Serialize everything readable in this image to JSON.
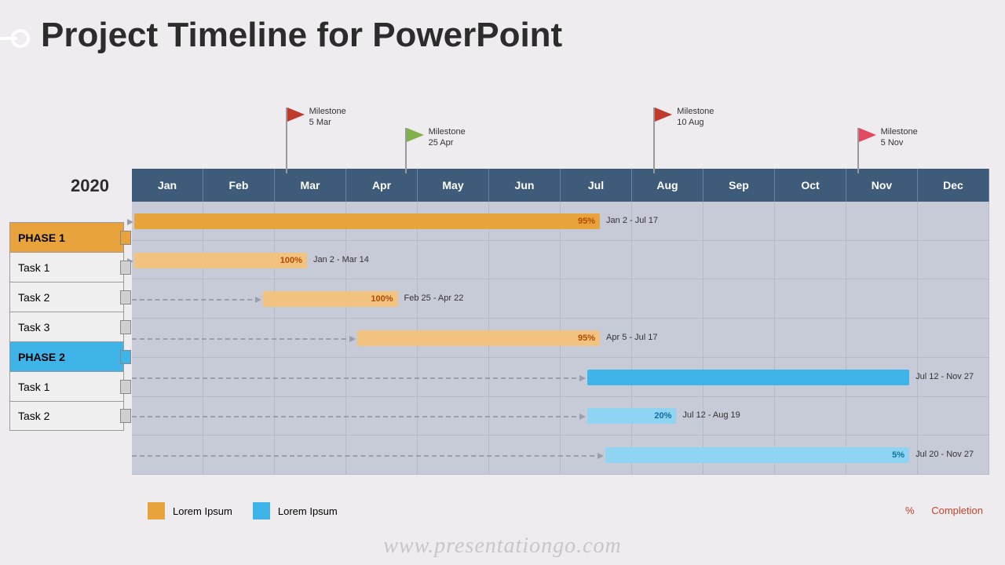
{
  "title": "Project Timeline for PowerPoint",
  "year": "2020",
  "months": [
    "Jan",
    "Feb",
    "Mar",
    "Apr",
    "May",
    "Jun",
    "Jul",
    "Aug",
    "Sep",
    "Oct",
    "Nov",
    "Dec"
  ],
  "rows": [
    {
      "label": "PHASE 1",
      "cls": "phase1",
      "handle": "p1"
    },
    {
      "label": "Task 1",
      "cls": "",
      "handle": ""
    },
    {
      "label": "Task 2",
      "cls": "",
      "handle": ""
    },
    {
      "label": "Task 3",
      "cls": "",
      "handle": ""
    },
    {
      "label": "PHASE 2",
      "cls": "phase2",
      "handle": "p2"
    },
    {
      "label": "Task 1",
      "cls": "",
      "handle": ""
    },
    {
      "label": "Task 2",
      "cls": "",
      "handle": ""
    }
  ],
  "milestones": [
    {
      "label1": "Milestone",
      "label2": "5 Mar",
      "color": "#c0392b",
      "col": 2.15,
      "high": true
    },
    {
      "label1": "Milestone",
      "label2": "25 Apr",
      "color": "#7fb24a",
      "col": 3.82,
      "high": false
    },
    {
      "label1": "Milestone",
      "label2": "10 Aug",
      "color": "#c0392b",
      "col": 7.3,
      "high": true
    },
    {
      "label1": "Milestone",
      "label2": "5 Nov",
      "color": "#e14b60",
      "col": 10.15,
      "high": false
    }
  ],
  "legend": [
    {
      "label": "Lorem Ipsum",
      "color": "#e8a33d"
    },
    {
      "label": "Lorem Ipsum",
      "color": "#3fb4e8"
    }
  ],
  "completion_pct": "%",
  "completion_label": "Completion",
  "watermark": "www.presentationgo.com",
  "chart_data": {
    "type": "gantt",
    "year": 2020,
    "x_axis_units": "months",
    "categories": [
      "Jan",
      "Feb",
      "Mar",
      "Apr",
      "May",
      "Jun",
      "Jul",
      "Aug",
      "Sep",
      "Oct",
      "Nov",
      "Dec"
    ],
    "rows": [
      {
        "name": "PHASE 1",
        "type": "phase",
        "start": "Jan 2",
        "end": "Jul 17",
        "start_m": 0.03,
        "end_m": 6.55,
        "pct": "95%",
        "color": "#e8a33d",
        "series": "Lorem Ipsum (orange)"
      },
      {
        "name": "Task 1",
        "type": "task",
        "start": "Jan 2",
        "end": "Mar 14",
        "start_m": 0.03,
        "end_m": 2.45,
        "pct": "100%",
        "color": "#f2c380",
        "series": "Lorem Ipsum (orange)"
      },
      {
        "name": "Task 2",
        "type": "task",
        "start": "Feb 25",
        "end": "Apr 22",
        "start_m": 1.83,
        "end_m": 3.72,
        "pct": "100%",
        "color": "#f2c380",
        "series": "Lorem Ipsum (orange)"
      },
      {
        "name": "Task 3",
        "type": "task",
        "start": "Apr 5",
        "end": "Jul 17",
        "start_m": 3.15,
        "end_m": 6.55,
        "pct": "95%",
        "color": "#f2c380",
        "series": "Lorem Ipsum (orange)"
      },
      {
        "name": "PHASE 2",
        "type": "phase",
        "start": "Jul 12",
        "end": "Nov 27",
        "start_m": 6.37,
        "end_m": 10.88,
        "pct": "",
        "color": "#3fb4e8",
        "series": "Lorem Ipsum (blue)"
      },
      {
        "name": "Task 1",
        "type": "task",
        "start": "Jul 12",
        "end": "Aug 19",
        "start_m": 6.37,
        "end_m": 7.62,
        "pct": "20%",
        "color": "#8fd4f2",
        "series": "Lorem Ipsum (blue)"
      },
      {
        "name": "Task 2",
        "type": "task",
        "start": "Jul 20",
        "end": "Nov 27",
        "start_m": 6.63,
        "end_m": 10.88,
        "pct": "5%",
        "color": "#8fd4f2",
        "series": "Lorem Ipsum (blue)"
      }
    ],
    "milestones": [
      {
        "label": "Milestone",
        "date": "5 Mar",
        "month_pos": 2.15
      },
      {
        "label": "Milestone",
        "date": "25 Apr",
        "month_pos": 3.82
      },
      {
        "label": "Milestone",
        "date": "10 Aug",
        "month_pos": 7.3
      },
      {
        "label": "Milestone",
        "date": "5 Nov",
        "month_pos": 10.15
      }
    ],
    "legend": [
      "Lorem Ipsum",
      "Lorem Ipsum"
    ],
    "annotation": "% Completion"
  }
}
